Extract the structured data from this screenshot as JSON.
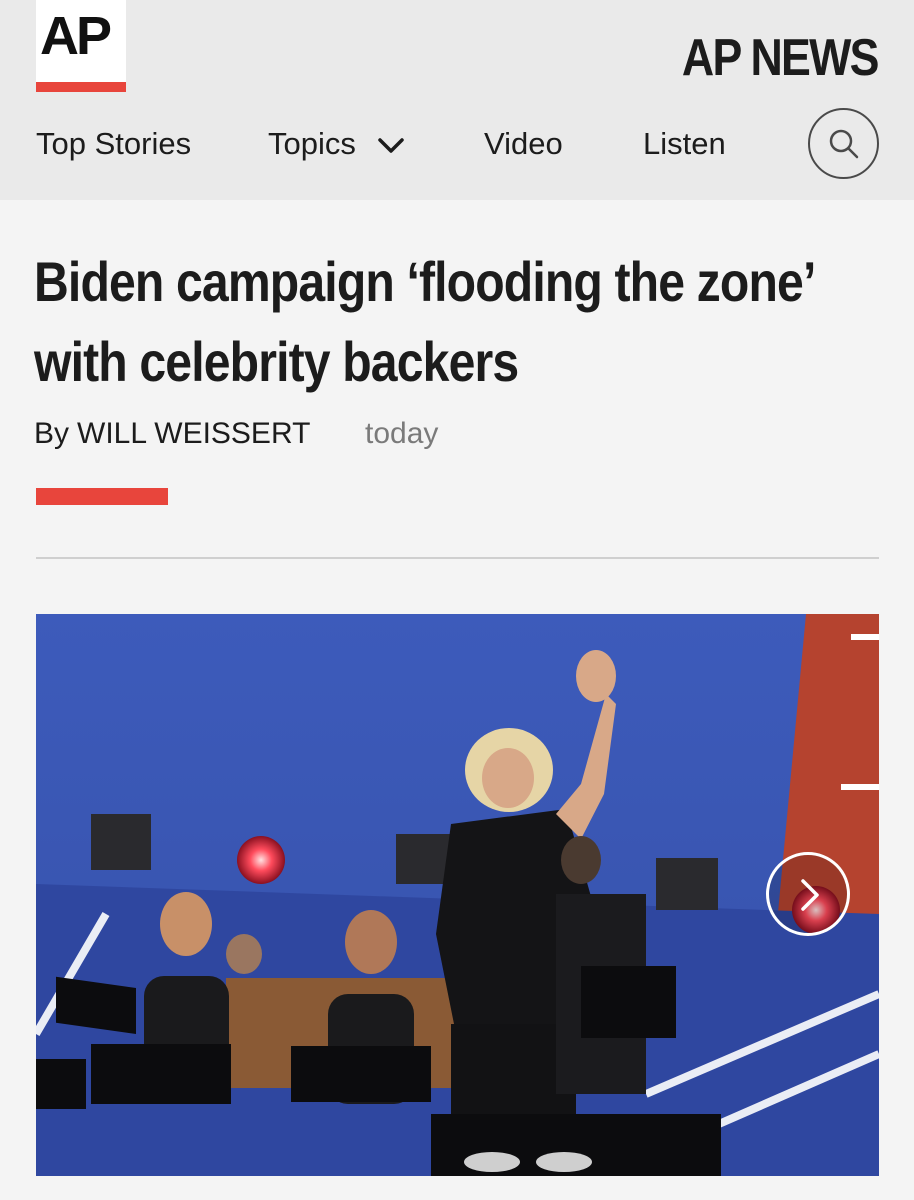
{
  "header": {
    "logo_text": "AP",
    "brand_title": "AP NEWS",
    "nav": {
      "top_stories": "Top Stories",
      "topics": "Topics",
      "video": "Video",
      "listen": "Listen"
    },
    "icons": {
      "topics_dropdown": "chevron-down-icon",
      "search": "search-icon"
    }
  },
  "article": {
    "headline": "Biden campaign ‘flooding the zone’ with celebrity backers",
    "byline_prefix": "By",
    "author": "WILL WEISSERT",
    "timestamp": "today",
    "hero_image": {
      "next_icon": "chevron-right-icon"
    }
  },
  "colors": {
    "accent_red": "#e8453c",
    "header_bg": "#eaeaea",
    "page_bg": "#f4f4f4",
    "text": "#1c1c1c",
    "muted_text": "#7a7a7a",
    "stage_blue": "#3f58b5"
  }
}
